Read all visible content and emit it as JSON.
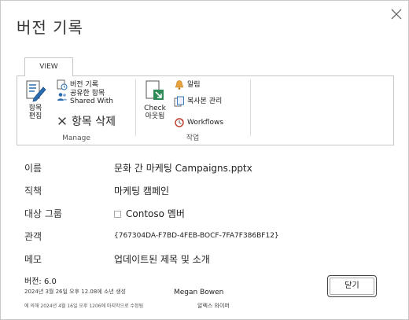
{
  "dialog": {
    "title": "버전 기록",
    "close_icon": "close-icon"
  },
  "ribbon": {
    "tab_label": "VIEW",
    "groups": {
      "manage": {
        "label": "Manage",
        "edit_item_line1": "항목",
        "edit_item_line2": "편집",
        "version_history": "버전 기록",
        "shared_with_ko": "공유한 항목",
        "shared_with_en": "Shared With",
        "delete_item": "항목 삭제"
      },
      "actions": {
        "label": "작업",
        "check_out_line1": "Check",
        "check_out_line2": "아웃됨",
        "alert": "알림",
        "manage_copies": "복사본 관리",
        "workflows": "Workflows"
      }
    }
  },
  "fields": [
    {
      "label": "이름",
      "value": "문화 간 마케팅 Campaigns.pptx"
    },
    {
      "label": "직책",
      "value": "마케팅 캠페인"
    },
    {
      "label": "대상 그룹",
      "value": "Contoso 멤버"
    },
    {
      "label": "관객",
      "value": "{767304DA-F7BD-4FEB-BOCF-7FA7F386BF12}"
    },
    {
      "label": "메모",
      "value": "업데이트된 제목 및 소개"
    }
  ],
  "footer": {
    "version": "버전: 6.0",
    "created_text": "2024년 3월 26일 오후 12.08에 소년 생성",
    "created_user": "Megan Bowen",
    "modified_text": "에 의해 2024년 4월 16일 오후 1206에 마지막으로 수정됨",
    "modified_user": "알렉스 와이퍼"
  },
  "buttons": {
    "close_label": "닫기"
  },
  "colors": {
    "accent_blue": "#2b6cb0",
    "delete_x": "#333333",
    "alert_orange": "#e8a33c",
    "workflow_red": "#c0392b",
    "border_gray": "#c6c6c6"
  }
}
